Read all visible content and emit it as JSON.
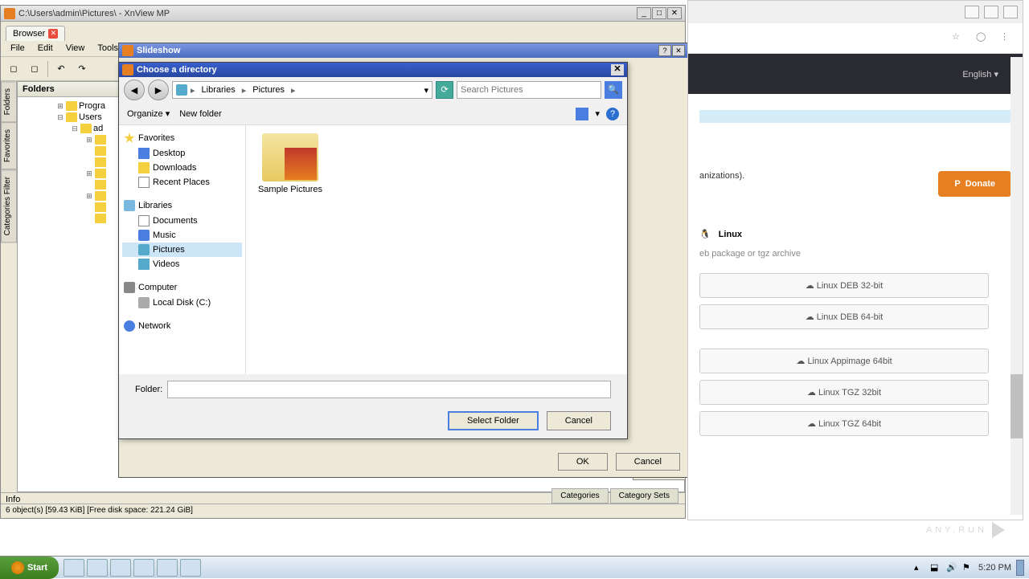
{
  "app": {
    "title": "C:\\Users\\admin\\Pictures\\ - XnView MP",
    "tab": "Browser",
    "menu": [
      "File",
      "Edit",
      "View",
      "Tools"
    ],
    "folders_header": "Folders",
    "side_tabs": [
      "Folders",
      "Favorites",
      "Categories Filter"
    ],
    "tree": [
      {
        "indent": 3,
        "toggle": "+",
        "label": "Progra"
      },
      {
        "indent": 3,
        "toggle": "-",
        "label": "Users"
      },
      {
        "indent": 4,
        "toggle": "-",
        "label": "ad"
      },
      {
        "indent": 5,
        "toggle": "+",
        "label": ""
      },
      {
        "indent": 5,
        "toggle": "",
        "label": ""
      },
      {
        "indent": 5,
        "toggle": "",
        "label": ""
      },
      {
        "indent": 5,
        "toggle": "+",
        "label": ""
      },
      {
        "indent": 5,
        "toggle": "",
        "label": ""
      },
      {
        "indent": 5,
        "toggle": "+",
        "label": ""
      },
      {
        "indent": 5,
        "toggle": "",
        "label": ""
      },
      {
        "indent": 5,
        "toggle": "",
        "label": ""
      }
    ],
    "info_label": "Info",
    "status": "6 object(s) [59.43 KiB] [Free disk space: 221.24 GiB]",
    "bottom_tabs": [
      "Categories",
      "Category Sets"
    ]
  },
  "slideshow": {
    "title": "Slideshow",
    "ok": "OK",
    "cancel": "Cancel"
  },
  "choose": {
    "title": "Choose a directory",
    "crumbs": [
      "Libraries",
      "Pictures"
    ],
    "search_placeholder": "Search Pictures",
    "organize": "Organize",
    "new_folder": "New folder",
    "sidebar": {
      "favorites": "Favorites",
      "favorites_items": [
        "Desktop",
        "Downloads",
        "Recent Places"
      ],
      "libraries": "Libraries",
      "libraries_items": [
        "Documents",
        "Music",
        "Pictures",
        "Videos"
      ],
      "computer": "Computer",
      "computer_items": [
        "Local Disk (C:)"
      ],
      "network": "Network"
    },
    "content_item": "Sample Pictures",
    "folder_label": "Folder:",
    "folder_value": "",
    "select": "Select Folder",
    "cancel": "Cancel"
  },
  "webpage": {
    "lang": "English",
    "text_frag": "anizations).",
    "donate": "Donate",
    "linux_header": "Linux",
    "linux_note": "eb package or tgz archive",
    "downloads_a": [
      "Linux DEB 32-bit",
      "Linux DEB 64-bit"
    ],
    "downloads_b": [
      "Linux Appimage 64bit",
      "Linux TGZ 32bit",
      "Linux TGZ 64bit"
    ]
  },
  "taskbar": {
    "start": "Start",
    "clock": "5:20 PM"
  },
  "watermark": "ANY.RUN"
}
